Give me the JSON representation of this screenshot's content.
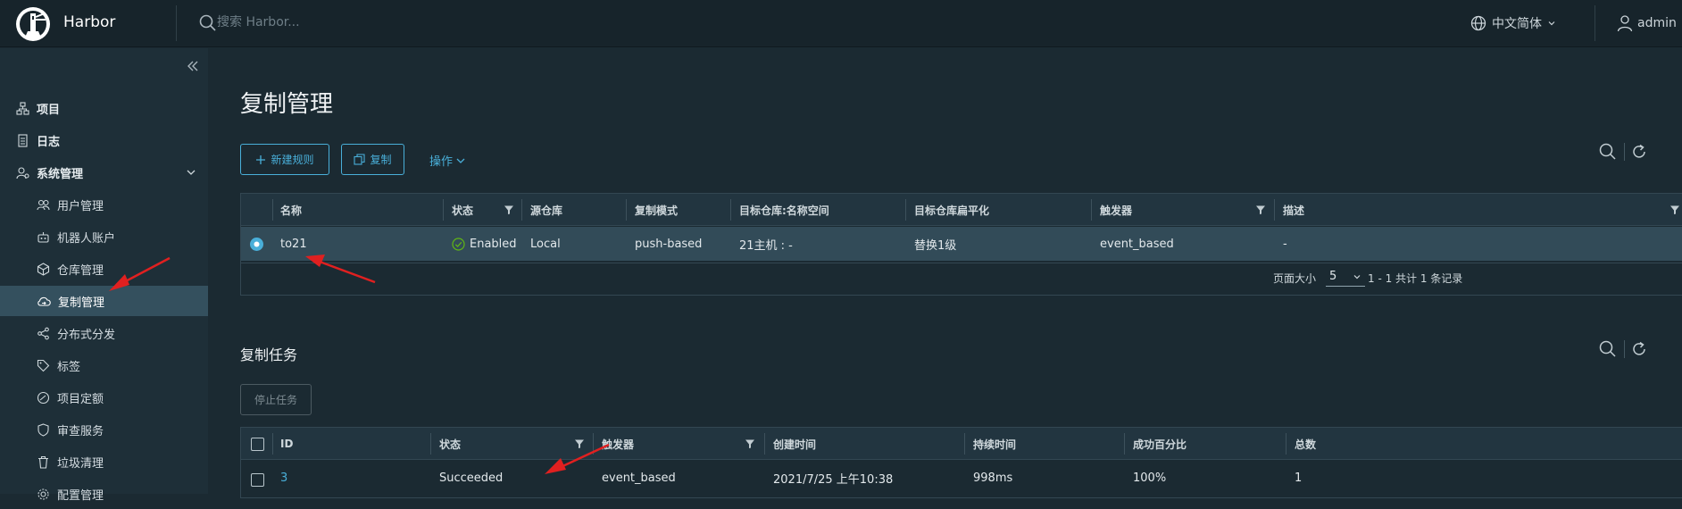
{
  "header": {
    "brand": "Harbor",
    "search_placeholder": "搜索 Harbor...",
    "language": "中文简体",
    "user": "admin"
  },
  "sidebar": {
    "items": [
      {
        "label": "项目",
        "icon": "project-icon"
      },
      {
        "label": "日志",
        "icon": "log-icon"
      },
      {
        "label": "系统管理",
        "icon": "admin-icon"
      },
      {
        "label": "用户管理",
        "icon": "users-icon"
      },
      {
        "label": "机器人账户",
        "icon": "robot-icon"
      },
      {
        "label": "仓库管理",
        "icon": "registry-icon"
      },
      {
        "label": "复制管理",
        "icon": "cloud-replication-icon"
      },
      {
        "label": "分布式分发",
        "icon": "share-icon"
      },
      {
        "label": "标签",
        "icon": "tag-icon"
      },
      {
        "label": "项目定额",
        "icon": "quota-icon"
      },
      {
        "label": "审查服务",
        "icon": "shield-icon"
      },
      {
        "label": "垃圾清理",
        "icon": "trash-icon"
      },
      {
        "label": "配置管理",
        "icon": "settings-icon"
      }
    ]
  },
  "main": {
    "title": "复制管理",
    "buttons": {
      "new_rule": "新建规则",
      "copy": "复制",
      "actions": "操作"
    },
    "rules_table": {
      "columns": [
        "名称",
        "状态",
        "源仓库",
        "复制模式",
        "目标仓库:名称空间",
        "目标仓库扁平化",
        "触发器",
        "描述"
      ],
      "rows": [
        {
          "name": "to21",
          "status": "Enabled",
          "source": "Local",
          "mode": "push-based",
          "dest": "21主机 : -",
          "flatten": "替换1级",
          "trigger": "event_based",
          "desc": "-"
        }
      ],
      "page_size_label": "页面大小",
      "page_size": "5",
      "summary": "1 - 1 共计 1 条记录"
    },
    "tasks": {
      "title": "复制任务",
      "stop_button": "停止任务",
      "columns": [
        "ID",
        "状态",
        "触发器",
        "创建时间",
        "持续时间",
        "成功百分比",
        "总数"
      ],
      "rows": [
        {
          "id": "3",
          "status": "Succeeded",
          "trigger": "event_based",
          "created": "2021/7/25 上午10:38",
          "duration": "998ms",
          "percent": "100%",
          "total": "1"
        }
      ]
    }
  },
  "colors": {
    "accent": "#49afd9",
    "success": "#60b515",
    "annotation_arrow": "#e02020"
  }
}
